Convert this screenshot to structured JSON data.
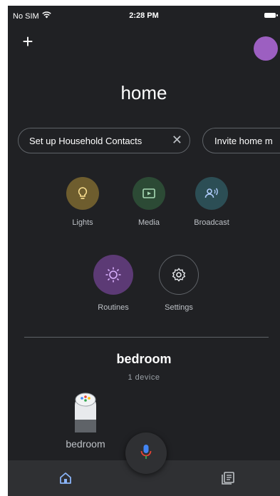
{
  "status_bar": {
    "carrier": "No SIM",
    "time": "2:28 PM"
  },
  "header": {
    "title": "home"
  },
  "chips": [
    {
      "label": "Set up Household Contacts"
    },
    {
      "label": "Invite home m"
    }
  ],
  "actions": [
    {
      "label": "Lights",
      "icon": "bulb-icon",
      "color": "#6e5d2e"
    },
    {
      "label": "Media",
      "icon": "media-icon",
      "color": "#2c4a35"
    },
    {
      "label": "Broadcast",
      "icon": "broadcast-icon",
      "color": "#2c4e55"
    },
    {
      "label": "Routines",
      "icon": "routines-icon",
      "color": "#5c3a75"
    },
    {
      "label": "Settings",
      "icon": "gear-icon",
      "color": "#202124"
    }
  ],
  "room": {
    "name": "bedroom",
    "devices": "1 device"
  },
  "device": {
    "label": "bedroom"
  },
  "nav": {
    "home_icon": "home-icon",
    "feed_icon": "feed-icon",
    "mic_icon": "mic-icon"
  }
}
